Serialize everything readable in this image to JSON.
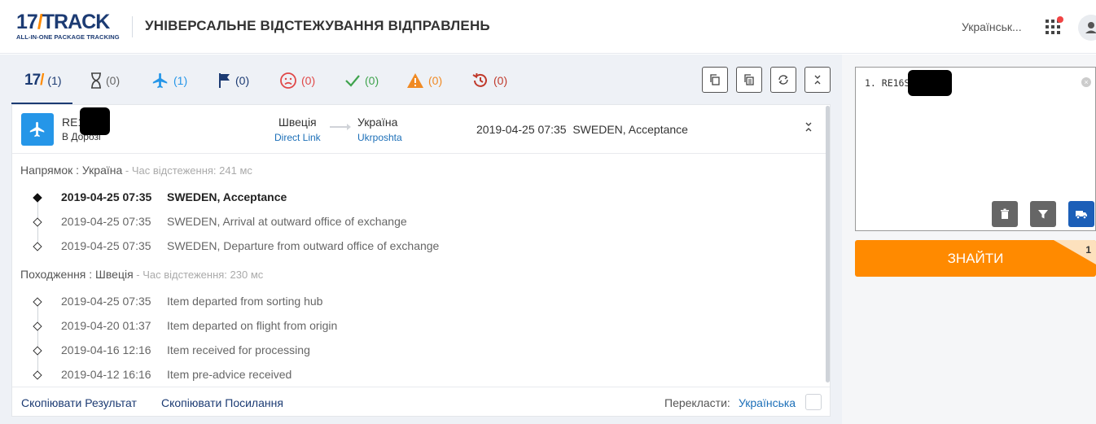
{
  "header": {
    "logo_main_left": "17",
    "logo_main_right": "TRACK",
    "logo_sub": "ALL-IN-ONE PACKAGE TRACKING",
    "title": "УНІВЕРСАЛЬНЕ ВІДСТЕЖУВАННЯ ВІДПРАВЛЕНЬ",
    "language": "Українськ..."
  },
  "tabs": [
    {
      "name": "all",
      "icon": "17track-icon",
      "count": "(1)",
      "color": "#1c3b73"
    },
    {
      "name": "not-found",
      "icon": "hourglass-icon",
      "count": "(0)",
      "color": "#666666"
    },
    {
      "name": "in-transit",
      "icon": "airplane-icon",
      "count": "(1)",
      "color": "#2596e8"
    },
    {
      "name": "pick-up",
      "icon": "flag-icon",
      "count": "(0)",
      "color": "#1c3b73"
    },
    {
      "name": "undelivered",
      "icon": "sad-face-icon",
      "count": "(0)",
      "color": "#e04848"
    },
    {
      "name": "delivered",
      "icon": "check-icon",
      "count": "(0)",
      "color": "#3fa34d"
    },
    {
      "name": "alert",
      "icon": "warning-icon",
      "count": "(0)",
      "color": "#f08a24"
    },
    {
      "name": "expired",
      "icon": "history-icon",
      "count": "(0)",
      "color": "#c0392b"
    }
  ],
  "toolbar": [
    "copy-icon",
    "copy-all-icon",
    "refresh-icon",
    "collapse-icon"
  ],
  "shipment": {
    "tracking_number": "RE16SE",
    "status": "В Дорозі",
    "origin_country": "Швеція",
    "origin_carrier": "Direct Link",
    "dest_country": "Україна",
    "dest_carrier": "Ukrposhta",
    "latest_time": "2019-04-25 07:35",
    "latest_event": "SWEDEN, Acceptance"
  },
  "destination_section": {
    "title": "Напрямок : Україна",
    "subtitle": " - Час відстеження: 241 мс",
    "events": [
      {
        "time": "2019-04-25 07:35",
        "desc": "SWEDEN, Acceptance"
      },
      {
        "time": "2019-04-25 07:35",
        "desc": "SWEDEN, Arrival at outward office of exchange"
      },
      {
        "time": "2019-04-25 07:35",
        "desc": "SWEDEN, Departure from outward office of exchange"
      }
    ]
  },
  "origin_section": {
    "title": "Походження : Швеція",
    "subtitle": " - Час відстеження: 230 мс",
    "events": [
      {
        "time": "2019-04-25 07:35",
        "desc": "Item departed from sorting hub"
      },
      {
        "time": "2019-04-20 01:37",
        "desc": "Item departed on flight from origin"
      },
      {
        "time": "2019-04-16 12:16",
        "desc": "Item received for processing"
      },
      {
        "time": "2019-04-12 16:16",
        "desc": "Item pre-advice received"
      }
    ]
  },
  "footer": {
    "copy_result": "Скопіювати Результат",
    "copy_link": "Скопіювати Посилання",
    "translate_label": "Перекласти:",
    "translate_lang": "Українська"
  },
  "input_panel": {
    "line": "1. RE16SE",
    "find_label": "ЗНАЙТИ",
    "find_count": "1"
  },
  "colors": {
    "brand_navy": "#1c3b73",
    "brand_orange": "#ff8a00",
    "transit_blue": "#2596e8"
  }
}
